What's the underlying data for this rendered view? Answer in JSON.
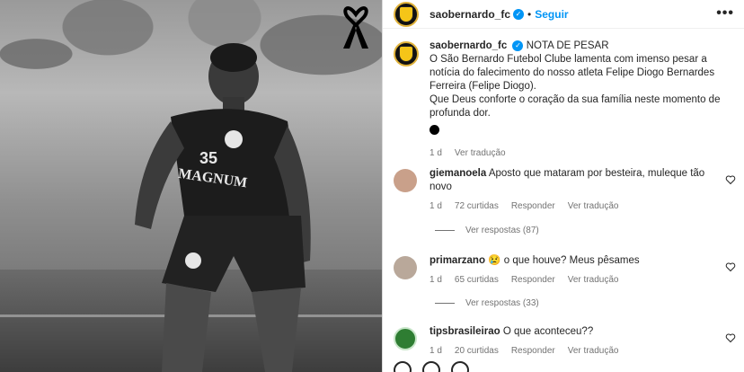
{
  "post": {
    "username": "saobernardo_fc",
    "dot": "•",
    "follow_label": "Seguir",
    "more_label": "•••"
  },
  "photo": {
    "jersey_number": "35",
    "jersey_sponsor": "MAGNUM"
  },
  "caption": {
    "username": "saobernardo_fc",
    "title": "NOTA DE PESAR",
    "text": "O São Bernardo Futebol Clube lamenta com imenso pesar a notícia do falecimento do nosso atleta Felipe Diogo Bernardes Ferreira (Felipe Diogo).",
    "text2": "Que Deus conforte o coração da sua família neste momento de profunda dor.",
    "time": "1 d",
    "translate": "Ver tradução"
  },
  "comments": [
    {
      "username": "giemanoela",
      "text": "Aposto que mataram por besteira, muleque tão novo",
      "time": "1 d",
      "likes": "72 curtidas",
      "reply": "Responder",
      "translate": "Ver tradução",
      "replies": "Ver respostas (87)",
      "avatar_color": "#c9a08a"
    },
    {
      "username": "primarzano",
      "emoji": "😢",
      "text": "o que houve? Meus pêsames",
      "time": "1 d",
      "likes": "65 curtidas",
      "reply": "Responder",
      "translate": "Ver tradução",
      "replies": "Ver respostas (33)",
      "avatar_color": "#b9a89a"
    },
    {
      "username": "tipsbrasileirao",
      "text": "O que aconteceu??",
      "time": "1 d",
      "likes": "20 curtidas",
      "reply": "Responder",
      "translate": "Ver tradução",
      "avatar_color": "#2e7d32"
    }
  ],
  "colors": {
    "accent": "#0095f6",
    "crest": "#f5c518"
  }
}
